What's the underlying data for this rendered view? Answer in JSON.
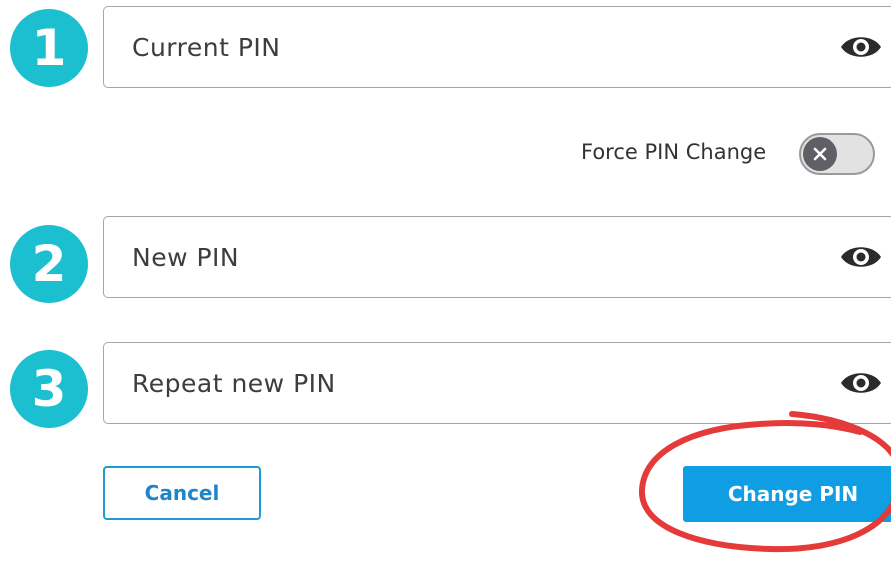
{
  "steps": [
    {
      "number": "1",
      "placeholder": "Current PIN",
      "value": "",
      "icon": "eye-icon"
    },
    {
      "number": "2",
      "placeholder": "New PIN",
      "value": "",
      "icon": "eye-icon"
    },
    {
      "number": "3",
      "placeholder": "Repeat new PIN",
      "value": "",
      "icon": "eye-icon"
    }
  ],
  "force_pin_change": {
    "label": "Force PIN Change",
    "enabled": false,
    "icon": "x-icon"
  },
  "buttons": {
    "cancel_label": "Cancel",
    "change_label": "Change PIN"
  },
  "colors": {
    "step_badge": "#1cbfcf",
    "primary_button": "#0f9ee3",
    "cancel_border": "#1e9bd7",
    "annotation": "#e53a3a"
  }
}
